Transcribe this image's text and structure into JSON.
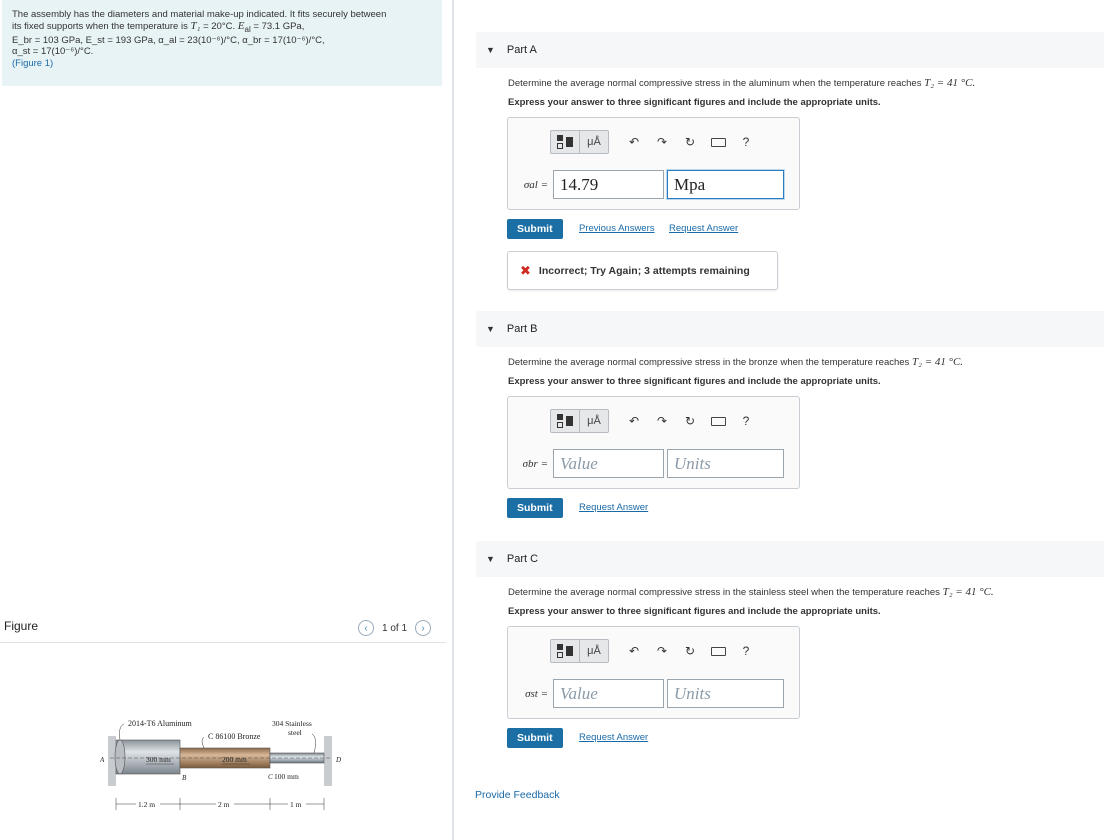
{
  "problem": {
    "line1": "The assembly has the diameters and material make-up indicated. It fits securely between",
    "line2_pre": "its fixed supports when the temperature is ",
    "line2_t1": "T₁",
    "line2_val": " = 20°C. ",
    "line2_eal": "E",
    "line2_eal_sub": "al",
    "line2_eal_val": " = 73.1 GPa,",
    "line3": "E_br = 103 GPa, E_st = 193 GPa, α_al = 23(10⁻⁶)/°C, α_br = 17(10⁻⁶)/°C,",
    "line4": "α_st = 17(10⁻⁶)/°C.",
    "figure_link": "(Figure 1)"
  },
  "figure": {
    "title": "Figure",
    "pager": "1 of 1",
    "labels": {
      "aluminum": "2014-T6 Aluminum",
      "bronze": "C 86100 Bronze",
      "steel_1": "304 Stainless",
      "steel_2": "steel",
      "d_al": "300 mm",
      "d_br": "200 mm",
      "d_st": "100 mm",
      "a": "A",
      "b": "B",
      "c": "C",
      "d": "D",
      "len_al": "1.2 m",
      "len_br": "2 m",
      "len_st": "1 m"
    }
  },
  "toolbar": {
    "units_symbol": "μÅ",
    "help": "?"
  },
  "parts": [
    {
      "header": "Part A",
      "prompt_pre": "Determine the average normal compressive stress in the aluminum when the temperature reaches ",
      "prompt_math": "T₂ = 41 °C.",
      "instruction": "Express your answer to three significant figures and include the appropriate units.",
      "label": "σal =",
      "value": "14.79",
      "units": "Mpa",
      "submit": "Submit",
      "previous": "Previous Answers",
      "request": "Request Answer",
      "feedback": "Incorrect; Try Again; 3 attempts remaining"
    },
    {
      "header": "Part B",
      "prompt_pre": "Determine the average normal compressive stress in the bronze when the temperature reaches ",
      "prompt_math": "T₂ = 41 °C.",
      "instruction": "Express your answer to three significant figures and include the appropriate units.",
      "label": "σbr =",
      "value_placeholder": "Value",
      "units_placeholder": "Units",
      "submit": "Submit",
      "request": "Request Answer"
    },
    {
      "header": "Part C",
      "prompt_pre": "Determine the average normal compressive stress in the stainless steel when the temperature reaches ",
      "prompt_math": "T₂ = 41 °C.",
      "instruction": "Express your answer to three significant figures and include the appropriate units.",
      "label": "σst =",
      "value_placeholder": "Value",
      "units_placeholder": "Units",
      "submit": "Submit",
      "request": "Request Answer"
    }
  ],
  "provide_feedback": "Provide Feedback"
}
